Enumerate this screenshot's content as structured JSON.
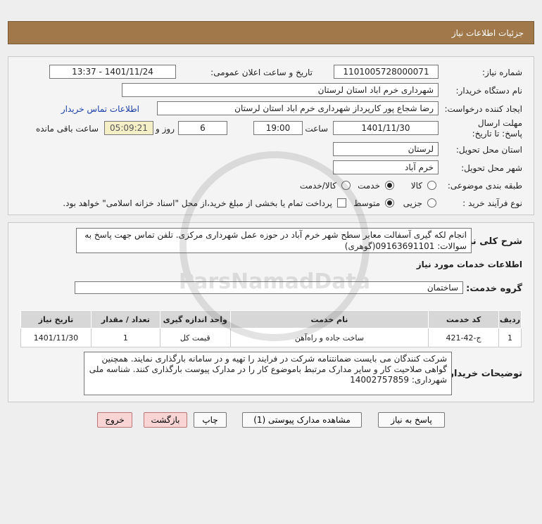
{
  "header": {
    "title": "جزئیات اطلاعات نیاز"
  },
  "form": {
    "need_number": {
      "label": "شماره نیاز:",
      "value": "1101005728000071"
    },
    "announce": {
      "label": "تاریخ و ساعت اعلان عمومی:",
      "value": "1401/11/24 - 13:37"
    },
    "buyer_org": {
      "label": "نام دستگاه خریدار:",
      "value": "شهرداری خرم اباد استان لرستان"
    },
    "requester": {
      "label": "ایجاد کننده درخواست:",
      "value": "رضا شجاع پور کارپرداز شهرداری خرم اباد استان لرستان",
      "contact_link": "اطلاعات تماس خریدار"
    },
    "deadline": {
      "label": "مهلت ارسال پاسخ: تا تاریخ:",
      "date": "1401/11/30",
      "time_label": "ساعت",
      "time": "19:00",
      "days": "6",
      "days_label": "روز و",
      "remaining": "05:09:21",
      "remaining_label": "ساعت باقی مانده"
    },
    "province": {
      "label": "استان محل تحویل:",
      "value": "لرستان"
    },
    "city": {
      "label": "شهر محل تحویل:",
      "value": "خرم آباد"
    },
    "category": {
      "label": "طبقه بندی موضوعی:",
      "options": [
        "کالا",
        "خدمت",
        "کالا/خدمت"
      ],
      "selected": "خدمت"
    },
    "purchase_type": {
      "label": "نوع فرآیند خرید :",
      "options": [
        "جزیی",
        "متوسط"
      ],
      "selected": "متوسط",
      "checkbox_text": "پرداخت تمام یا بخشی از مبلغ خرید،از محل \"اسناد خزانه اسلامی\" خواهد بود."
    }
  },
  "details": {
    "summary_label": "شرح کلی نیاز:",
    "summary": "انجام لکه گیری آسفالت معابر سطح شهر خرم آباد در حوزه عمل شهرداری مرکزی. تلفن تماس جهت پاسخ به سوالات: 09163691101(گوهری)",
    "services_title": "اطلاعات خدمات مورد نیاز",
    "service_group_label": "گروه خدمت:",
    "service_group": "ساختمان",
    "table": {
      "headers": [
        "ردیف",
        "کد خدمت",
        "نام خدمت",
        "واحد اندازه گیری",
        "تعداد / مقدار",
        "تاریخ نیاز"
      ],
      "rows": [
        [
          "1",
          "ج-42-421",
          "ساخت جاده و راه‌آهن",
          "قیمت کل",
          "1",
          "1401/11/30"
        ]
      ]
    },
    "buyer_notes_label": "توضیحات خریدار:",
    "buyer_notes": "شرکت کنندگان می بایست ضمانتنامه شرکت در فرایند را تهیه و در سامانه بارگذاری نمایند. همچنین گواهی صلاحیت کار و سایر مدارک مرتبط باموضوع کار را در مدارک پیوست بارگذاری کنند. شناسه ملی شهرداری: 14002757859"
  },
  "buttons": {
    "reply": "پاسخ به نیاز",
    "attachments": "مشاهده مدارک پیوستی (1)",
    "print": "چاپ",
    "back": "بازگشت",
    "exit": "خروج"
  },
  "watermark": {
    "text": "ParsNamadData"
  },
  "colors": {
    "header_bg": "#a0784a",
    "link": "#1a3ea8",
    "remaining_bg": "#f5efc8",
    "exit_bg": "#f8d4d4"
  }
}
